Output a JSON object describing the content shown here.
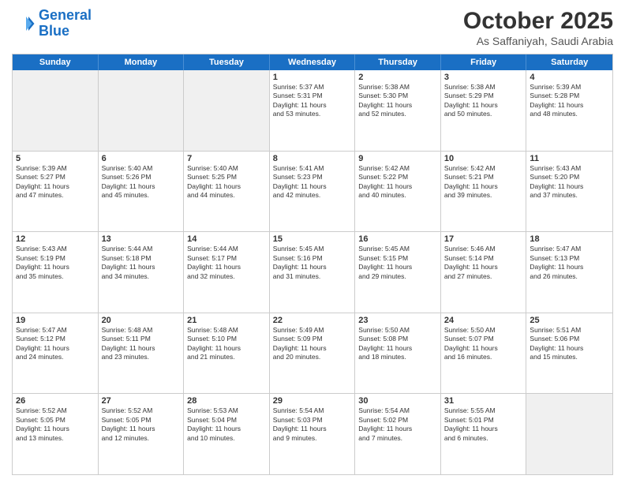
{
  "logo": {
    "line1": "General",
    "line2": "Blue"
  },
  "title": "October 2025",
  "location": "As Saffaniyah, Saudi Arabia",
  "weekdays": [
    "Sunday",
    "Monday",
    "Tuesday",
    "Wednesday",
    "Thursday",
    "Friday",
    "Saturday"
  ],
  "weeks": [
    [
      {
        "day": "",
        "text": ""
      },
      {
        "day": "",
        "text": ""
      },
      {
        "day": "",
        "text": ""
      },
      {
        "day": "1",
        "text": "Sunrise: 5:37 AM\nSunset: 5:31 PM\nDaylight: 11 hours\nand 53 minutes."
      },
      {
        "day": "2",
        "text": "Sunrise: 5:38 AM\nSunset: 5:30 PM\nDaylight: 11 hours\nand 52 minutes."
      },
      {
        "day": "3",
        "text": "Sunrise: 5:38 AM\nSunset: 5:29 PM\nDaylight: 11 hours\nand 50 minutes."
      },
      {
        "day": "4",
        "text": "Sunrise: 5:39 AM\nSunset: 5:28 PM\nDaylight: 11 hours\nand 48 minutes."
      }
    ],
    [
      {
        "day": "5",
        "text": "Sunrise: 5:39 AM\nSunset: 5:27 PM\nDaylight: 11 hours\nand 47 minutes."
      },
      {
        "day": "6",
        "text": "Sunrise: 5:40 AM\nSunset: 5:26 PM\nDaylight: 11 hours\nand 45 minutes."
      },
      {
        "day": "7",
        "text": "Sunrise: 5:40 AM\nSunset: 5:25 PM\nDaylight: 11 hours\nand 44 minutes."
      },
      {
        "day": "8",
        "text": "Sunrise: 5:41 AM\nSunset: 5:23 PM\nDaylight: 11 hours\nand 42 minutes."
      },
      {
        "day": "9",
        "text": "Sunrise: 5:42 AM\nSunset: 5:22 PM\nDaylight: 11 hours\nand 40 minutes."
      },
      {
        "day": "10",
        "text": "Sunrise: 5:42 AM\nSunset: 5:21 PM\nDaylight: 11 hours\nand 39 minutes."
      },
      {
        "day": "11",
        "text": "Sunrise: 5:43 AM\nSunset: 5:20 PM\nDaylight: 11 hours\nand 37 minutes."
      }
    ],
    [
      {
        "day": "12",
        "text": "Sunrise: 5:43 AM\nSunset: 5:19 PM\nDaylight: 11 hours\nand 35 minutes."
      },
      {
        "day": "13",
        "text": "Sunrise: 5:44 AM\nSunset: 5:18 PM\nDaylight: 11 hours\nand 34 minutes."
      },
      {
        "day": "14",
        "text": "Sunrise: 5:44 AM\nSunset: 5:17 PM\nDaylight: 11 hours\nand 32 minutes."
      },
      {
        "day": "15",
        "text": "Sunrise: 5:45 AM\nSunset: 5:16 PM\nDaylight: 11 hours\nand 31 minutes."
      },
      {
        "day": "16",
        "text": "Sunrise: 5:45 AM\nSunset: 5:15 PM\nDaylight: 11 hours\nand 29 minutes."
      },
      {
        "day": "17",
        "text": "Sunrise: 5:46 AM\nSunset: 5:14 PM\nDaylight: 11 hours\nand 27 minutes."
      },
      {
        "day": "18",
        "text": "Sunrise: 5:47 AM\nSunset: 5:13 PM\nDaylight: 11 hours\nand 26 minutes."
      }
    ],
    [
      {
        "day": "19",
        "text": "Sunrise: 5:47 AM\nSunset: 5:12 PM\nDaylight: 11 hours\nand 24 minutes."
      },
      {
        "day": "20",
        "text": "Sunrise: 5:48 AM\nSunset: 5:11 PM\nDaylight: 11 hours\nand 23 minutes."
      },
      {
        "day": "21",
        "text": "Sunrise: 5:48 AM\nSunset: 5:10 PM\nDaylight: 11 hours\nand 21 minutes."
      },
      {
        "day": "22",
        "text": "Sunrise: 5:49 AM\nSunset: 5:09 PM\nDaylight: 11 hours\nand 20 minutes."
      },
      {
        "day": "23",
        "text": "Sunrise: 5:50 AM\nSunset: 5:08 PM\nDaylight: 11 hours\nand 18 minutes."
      },
      {
        "day": "24",
        "text": "Sunrise: 5:50 AM\nSunset: 5:07 PM\nDaylight: 11 hours\nand 16 minutes."
      },
      {
        "day": "25",
        "text": "Sunrise: 5:51 AM\nSunset: 5:06 PM\nDaylight: 11 hours\nand 15 minutes."
      }
    ],
    [
      {
        "day": "26",
        "text": "Sunrise: 5:52 AM\nSunset: 5:05 PM\nDaylight: 11 hours\nand 13 minutes."
      },
      {
        "day": "27",
        "text": "Sunrise: 5:52 AM\nSunset: 5:05 PM\nDaylight: 11 hours\nand 12 minutes."
      },
      {
        "day": "28",
        "text": "Sunrise: 5:53 AM\nSunset: 5:04 PM\nDaylight: 11 hours\nand 10 minutes."
      },
      {
        "day": "29",
        "text": "Sunrise: 5:54 AM\nSunset: 5:03 PM\nDaylight: 11 hours\nand 9 minutes."
      },
      {
        "day": "30",
        "text": "Sunrise: 5:54 AM\nSunset: 5:02 PM\nDaylight: 11 hours\nand 7 minutes."
      },
      {
        "day": "31",
        "text": "Sunrise: 5:55 AM\nSunset: 5:01 PM\nDaylight: 11 hours\nand 6 minutes."
      },
      {
        "day": "",
        "text": ""
      }
    ]
  ]
}
